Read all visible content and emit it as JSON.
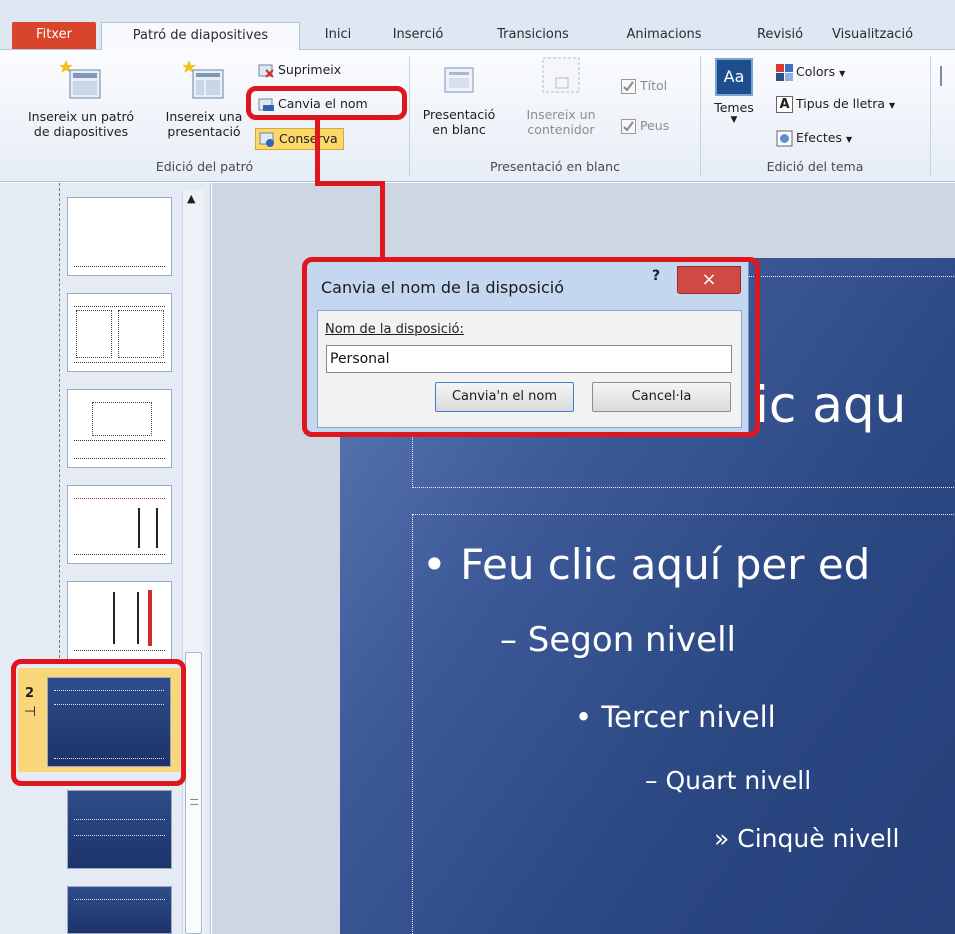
{
  "tabs": {
    "file": "Fitxer",
    "slide_master": "Patró de diapositives",
    "home": "Inici",
    "insert": "Inserció",
    "transitions": "Transicions",
    "animations": "Animacions",
    "review": "Revisió",
    "view": "Visualització"
  },
  "ribbon": {
    "insert_master_line1": "Insereix un patró",
    "insert_master_line2": "de diapositives",
    "insert_layout_line1": "Insereix una",
    "insert_layout_line2": "presentació",
    "delete": "Suprimeix",
    "rename": "Canvia el nom",
    "preserve": "Conserva",
    "group_master_editing": "Edició del patró",
    "blank_layout_line1": "Presentació",
    "blank_layout_line2": "en blanc",
    "insert_placeholder_line1": "Insereix un",
    "insert_placeholder_line2": "contenidor",
    "title_check": "Títol",
    "footers_check": "Peus",
    "group_blank_layout": "Presentació en blanc",
    "themes": "Temes",
    "themes_icon_text": "Aa",
    "colors": "Colors",
    "fonts": "Tipus de lletra",
    "fonts_icon_text": "A",
    "effects": "Efectes",
    "group_edit_theme": "Edició del tema"
  },
  "thumbnails": {
    "selected_number": "2"
  },
  "dialog": {
    "title": "Canvia el nom de la disposició",
    "help": "?",
    "close": "×",
    "label": "Nom de la disposició:",
    "value": "Personal",
    "rename_button": "Canvia'n el nom",
    "cancel_button": "Cancel·la"
  },
  "slide": {
    "title_partial": "ic aqu",
    "level1": "• Feu clic aquí per ed",
    "level2": "– Segon nivell",
    "level3": "• Tercer nivell",
    "level4": "– Quart nivell",
    "level5": "» Cinquè nivell"
  },
  "colors": {
    "file_tab": "#d9452b",
    "highlight": "#e0161e",
    "preserve_bg": "#fbd86a",
    "slide_bg": "#3c5897"
  }
}
